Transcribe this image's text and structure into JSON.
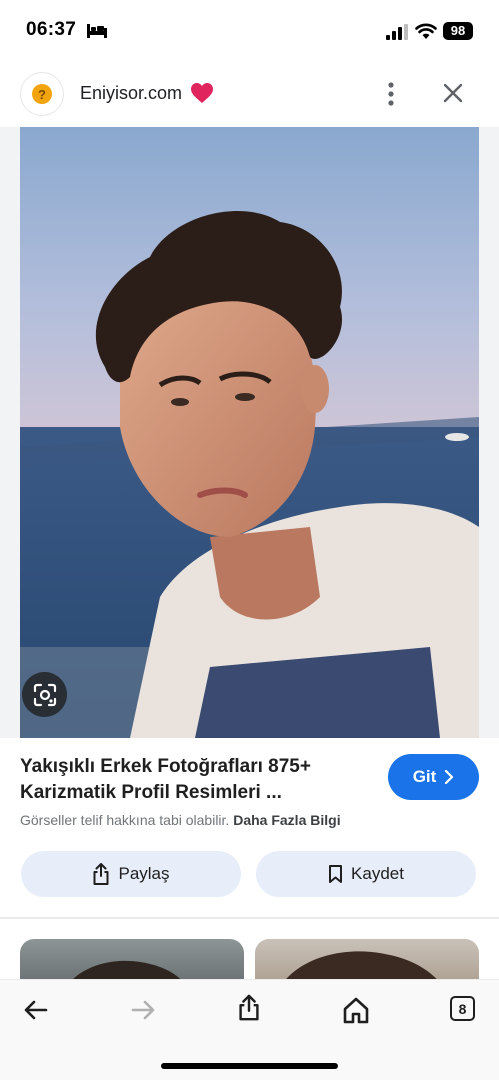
{
  "status_bar": {
    "time": "06:37",
    "battery": "98"
  },
  "header": {
    "site_name": "Eniyisor.com",
    "logo_glyph": "?",
    "icons": [
      "bed-icon",
      "signal-icon",
      "wifi-icon",
      "heart-icon",
      "more-vertical-icon",
      "close-icon"
    ]
  },
  "image": {
    "subject": "photo",
    "lens_icon": "lens-icon"
  },
  "result": {
    "title": "Yakışıklı Erkek Fotoğrafları 875+ Karizmatik Profil Resimleri ...",
    "go_label": "Git",
    "notice_text": "Görseller telif hakkına tabi olabilir.",
    "more_info": "Daha Fazla Bilgi"
  },
  "actions": {
    "share_label": "Paylaş",
    "save_label": "Kaydet"
  },
  "toolbar": {
    "tabs_count": "8"
  },
  "colors": {
    "accent": "#1a73e8",
    "action_bg": "#e8eef9",
    "heart": "#e0245e"
  }
}
